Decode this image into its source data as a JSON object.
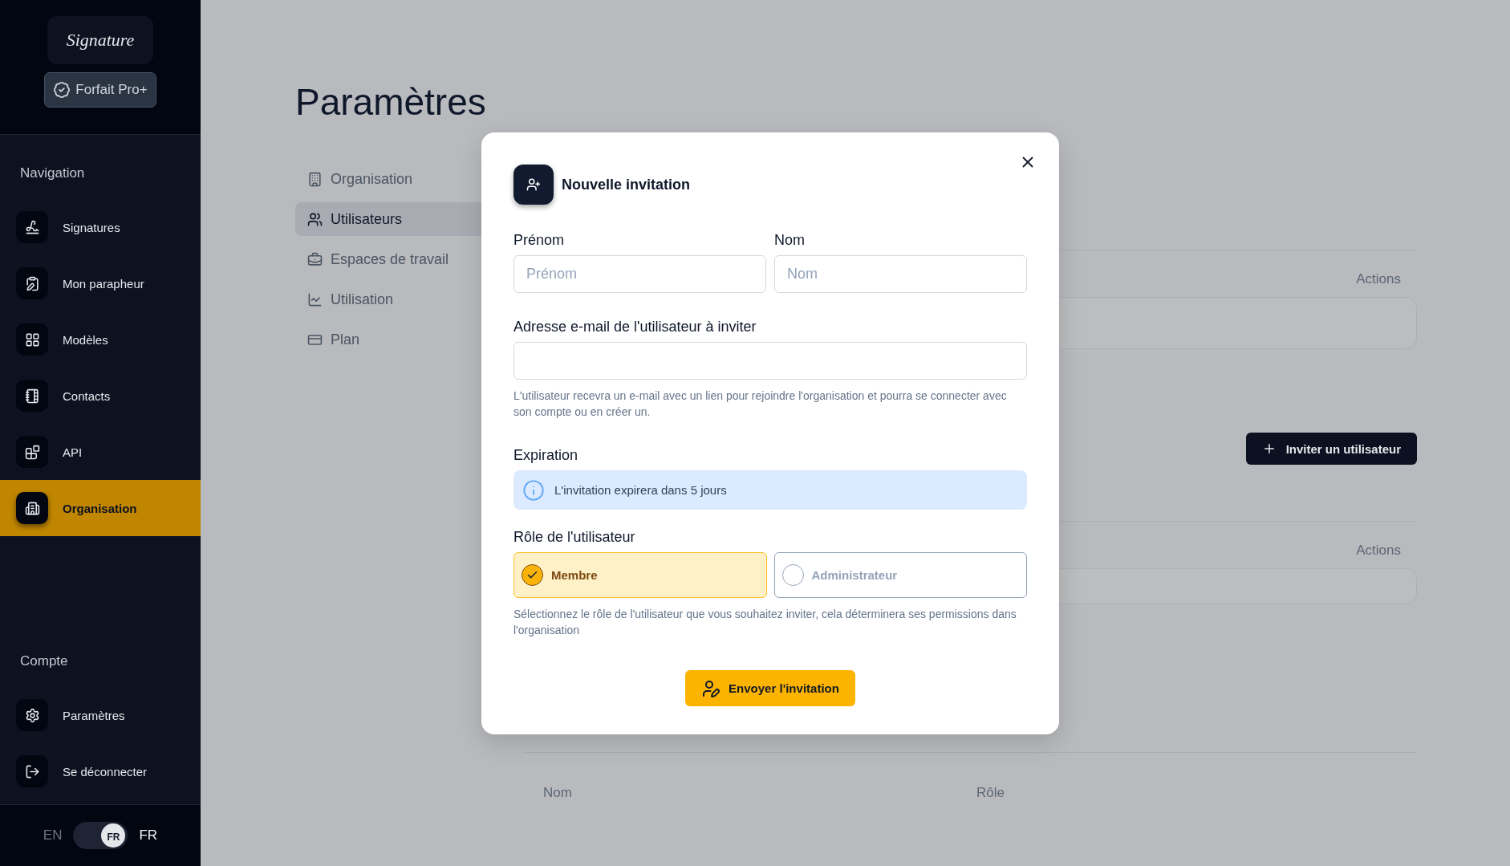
{
  "sidebar": {
    "logo": "Signature",
    "plan_badge": "Forfait Pro+",
    "sections": [
      {
        "title": "Navigation",
        "items": [
          {
            "label": "Signatures",
            "selected": false
          },
          {
            "label": "Mon parapheur",
            "selected": false
          },
          {
            "label": "Modèles",
            "selected": false
          },
          {
            "label": "Contacts",
            "selected": false
          },
          {
            "label": "API",
            "selected": false
          },
          {
            "label": "Organisation",
            "selected": true
          }
        ]
      },
      {
        "title": "Compte",
        "items": [
          {
            "label": "Paramètres",
            "selected": false
          },
          {
            "label": "Se déconnecter",
            "selected": false
          }
        ]
      }
    ],
    "language_toggle": {
      "left": "EN",
      "right": "FR",
      "knob": "FR",
      "on": true
    }
  },
  "page": {
    "title": "Paramètres",
    "settings_nav": [
      {
        "label": "Organisation",
        "selected": false
      },
      {
        "label": "Utilisateurs",
        "selected": true
      },
      {
        "label": "Espaces de travail",
        "selected": false
      },
      {
        "label": "Utilisation",
        "selected": false
      },
      {
        "label": "Plan",
        "selected": false
      }
    ],
    "tables": [
      {
        "column_header": "Actions"
      },
      {
        "column_header": "Actions"
      }
    ],
    "invite_button": "Inviter un utilisateur",
    "bottom_table_headers": [
      "Nom",
      "Rôle"
    ]
  },
  "modal": {
    "title": "Nouvelle invitation",
    "first_name": {
      "label": "Prénom",
      "placeholder": "Prénom"
    },
    "last_name": {
      "label": "Nom",
      "placeholder": "Nom"
    },
    "email": {
      "label": "Adresse e-mail de l'utilisateur à inviter",
      "help": "L'utilisateur recevra un e-mail avec un lien pour rejoindre l'organisation et pourra se connecter avec son compte ou en créer un."
    },
    "expiration": {
      "label": "Expiration",
      "info": "L'invitation expirera dans 5 jours"
    },
    "role": {
      "label": "Rôle de l'utilisateur",
      "options": [
        {
          "label": "Membre",
          "selected": true
        },
        {
          "label": "Administrateur",
          "selected": false
        }
      ],
      "help": "Sélectionnez le rôle de l'utilisateur que vous souhaitez inviter, cela déterminera ses permissions dans l'organisation"
    },
    "submit": "Envoyer l'invitation"
  }
}
